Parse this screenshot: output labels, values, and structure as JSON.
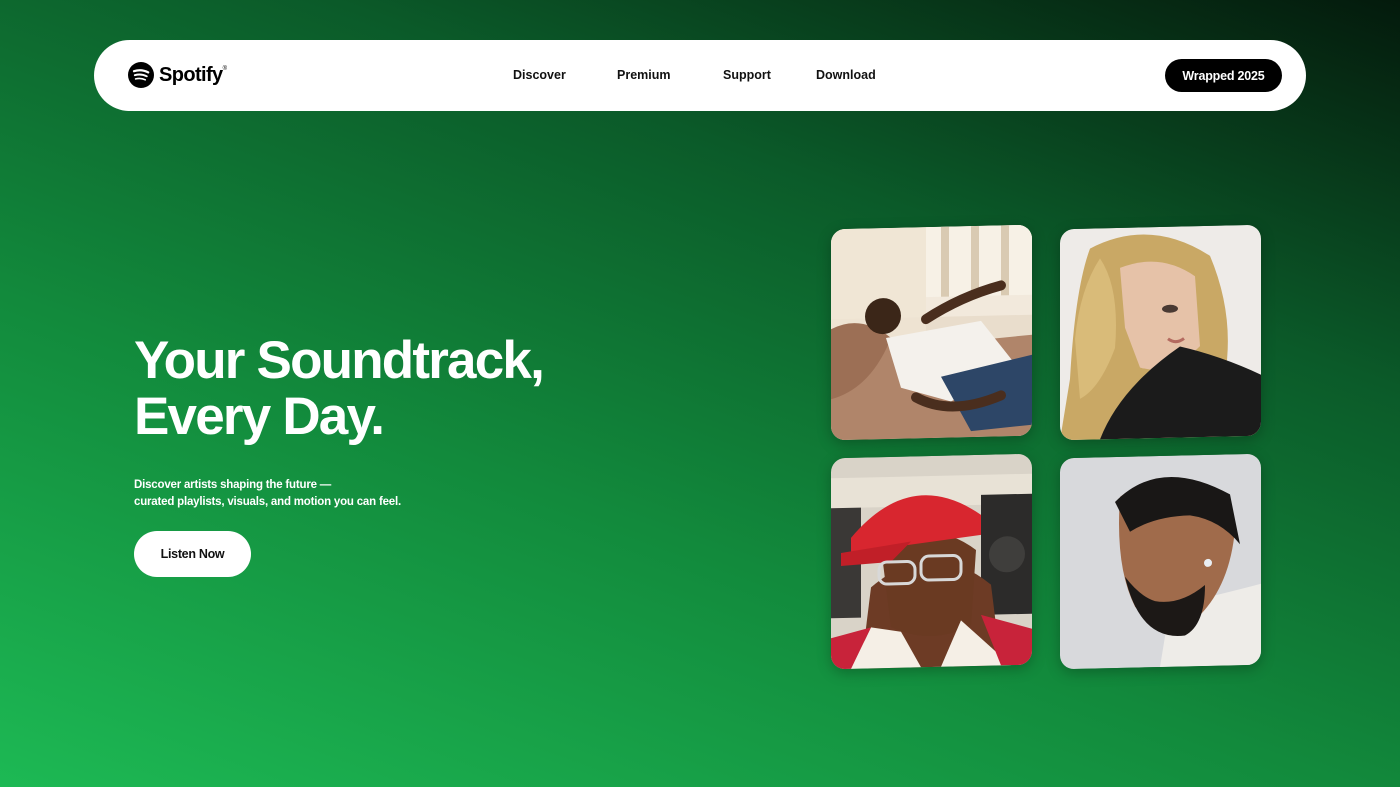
{
  "brand": {
    "name": "Spotify",
    "icon": "spotify-logo-icon",
    "color": "#1db954"
  },
  "nav": {
    "links": [
      "Discover",
      "Premium",
      "Support",
      "Download"
    ],
    "cta_label": "Wrapped 2025"
  },
  "hero": {
    "title_line1": "Your Soundtrack,",
    "title_line2": "Every Day.",
    "subtitle_line1": "Discover artists shaping the future —",
    "subtitle_line2": "curated playlists, visuals, and motion you can feel.",
    "button_label": "Listen Now"
  },
  "artists": [
    {
      "description": "artist-photo-reclining-white-tee"
    },
    {
      "description": "artist-photo-blonde-portrait"
    },
    {
      "description": "artist-photo-red-cap-glasses"
    },
    {
      "description": "artist-photo-braids-profile"
    }
  ]
}
